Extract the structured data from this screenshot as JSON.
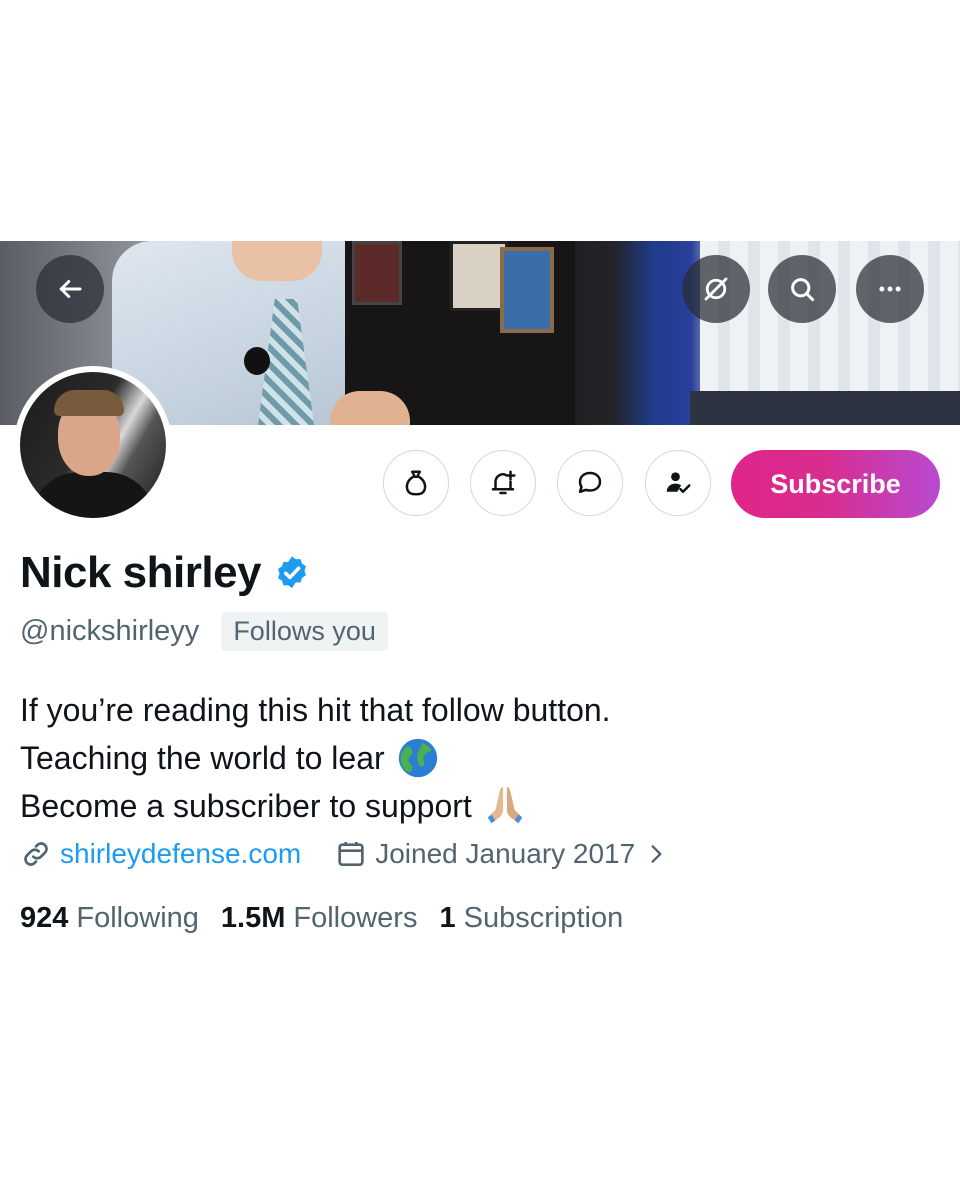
{
  "header": {
    "back_icon": "arrow-left-icon",
    "actions": [
      "grok-icon",
      "search-icon",
      "more-icon"
    ]
  },
  "profile": {
    "name": "Nick shirley",
    "handle": "@nickshirleyy",
    "follows_badge": "Follows you",
    "verified": true,
    "verified_color": "#1d9bf0"
  },
  "buttons": {
    "tip_icon": "money-bag-icon",
    "notify_icon": "bell-plus-icon",
    "message_icon": "message-icon",
    "following_icon": "person-check-icon",
    "subscribe_label": "Subscribe"
  },
  "bio": {
    "line1": "If you’re reading this hit that follow button.",
    "line2": "Teaching the world to lear",
    "line3": "Become a subscriber to support"
  },
  "meta": {
    "website": "shirleydefense.com",
    "joined": "Joined January 2017"
  },
  "stats": {
    "following_count": "924",
    "following_label": "Following",
    "followers_count": "1.5M",
    "followers_label": "Followers",
    "subscription_count": "1",
    "subscription_label": "Subscription"
  },
  "colors": {
    "accent": "#1d9bf0",
    "subscribe_start": "#e0248a",
    "subscribe_end": "#b84ad1",
    "secondary_text": "#536471"
  }
}
